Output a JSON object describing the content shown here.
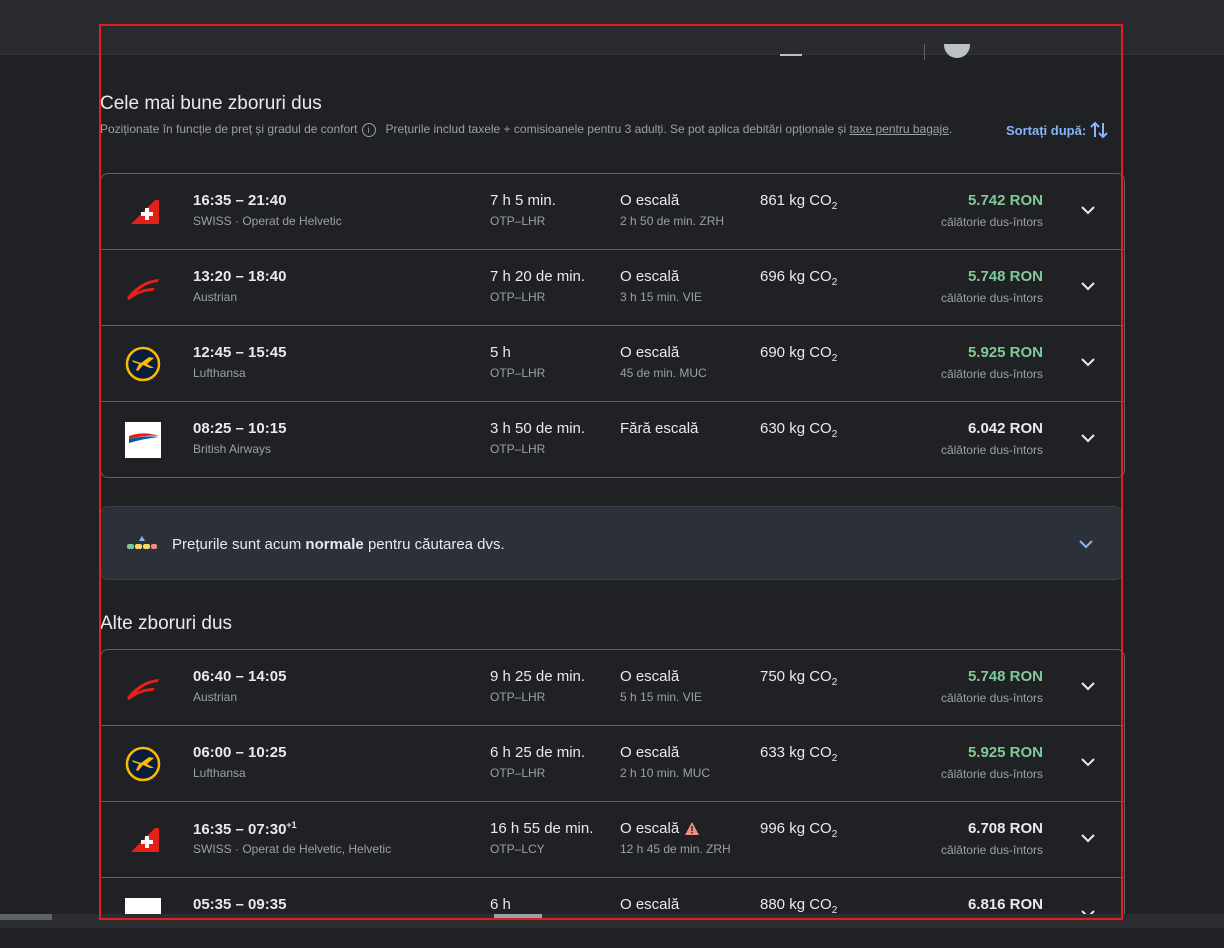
{
  "colors": {
    "accent_green": "#81c995",
    "link_blue": "#8ab4f8",
    "frame_red": "#e02020"
  },
  "best": {
    "title": "Cele mai bune zboruri dus",
    "subtitle_rank": "Poziționate în funcție de preț și gradul de confort",
    "subtitle_prices": "Prețurile includ taxele + comisioanele pentru 3 adulți. Se pot aplica debitări opționale și",
    "subtitle_link": "taxe pentru bagaje",
    "subtitle_end": "."
  },
  "sort": {
    "label": "Sortați după:"
  },
  "flights_best": [
    {
      "times": "16:35 – 21:40",
      "plus": "",
      "airline": "SWISS · Operat de Helvetic",
      "logo": "swiss",
      "duration": "7 h 5 min.",
      "route": "OTP–LHR",
      "stops": "O escală",
      "warning": false,
      "stop_info": "2 h 50 de min. ZRH",
      "co2": "861 kg CO",
      "price": "5.742 RON",
      "green": true,
      "price_type": "călătorie dus-întors"
    },
    {
      "times": "13:20 – 18:40",
      "plus": "",
      "airline": "Austrian",
      "logo": "austrian",
      "duration": "7 h 20 de min.",
      "route": "OTP–LHR",
      "stops": "O escală",
      "warning": false,
      "stop_info": "3 h 15 min. VIE",
      "co2": "696 kg CO",
      "price": "5.748 RON",
      "green": true,
      "price_type": "călătorie dus-întors"
    },
    {
      "times": "12:45 – 15:45",
      "plus": "",
      "airline": "Lufthansa",
      "logo": "lufthansa",
      "duration": "5 h",
      "route": "OTP–LHR",
      "stops": "O escală",
      "warning": false,
      "stop_info": "45 de min. MUC",
      "co2": "690 kg CO",
      "price": "5.925 RON",
      "green": true,
      "price_type": "călătorie dus-întors"
    },
    {
      "times": "08:25 – 10:15",
      "plus": "",
      "airline": "British Airways",
      "logo": "ba",
      "duration": "3 h 50 de min.",
      "route": "OTP–LHR",
      "stops": "Fără escală",
      "warning": false,
      "stop_info": "",
      "co2": "630 kg CO",
      "price": "6.042 RON",
      "green": false,
      "price_type": "călătorie dus-întors"
    }
  ],
  "insight": {
    "prefix": "Prețurile sunt acum",
    "emphasis": "normale",
    "suffix": "pentru căutarea dvs."
  },
  "other": {
    "title": "Alte zboruri dus"
  },
  "flights_other": [
    {
      "times": "06:40 – 14:05",
      "plus": "",
      "airline": "Austrian",
      "logo": "austrian",
      "duration": "9 h 25 de min.",
      "route": "OTP–LHR",
      "stops": "O escală",
      "warning": false,
      "stop_info": "5 h 15 min. VIE",
      "co2": "750 kg CO",
      "price": "5.748 RON",
      "green": true,
      "price_type": "călătorie dus-întors"
    },
    {
      "times": "06:00 – 10:25",
      "plus": "",
      "airline": "Lufthansa",
      "logo": "lufthansa",
      "duration": "6 h 25 de min.",
      "route": "OTP–LHR",
      "stops": "O escală",
      "warning": false,
      "stop_info": "2 h 10 min. MUC",
      "co2": "633 kg CO",
      "price": "5.925 RON",
      "green": true,
      "price_type": "călătorie dus-întors"
    },
    {
      "times": "16:35 – 07:30",
      "plus": "+1",
      "airline": "SWISS · Operat de Helvetic, Helvetic",
      "logo": "swiss",
      "duration": "16 h 55 de min.",
      "route": "OTP–LCY",
      "stops": "O escală",
      "warning": true,
      "stop_info": "12 h 45 de min. ZRH",
      "co2": "996 kg CO",
      "price": "6.708 RON",
      "green": false,
      "price_type": "călătorie dus-întors"
    },
    {
      "times": "05:35 – 09:35",
      "plus": "",
      "airline": "",
      "logo": "lot",
      "duration": "6 h",
      "route": "",
      "stops": "O escală",
      "warning": false,
      "stop_info": "",
      "co2": "880 kg CO",
      "price": "6.816 RON",
      "green": false,
      "price_type": ""
    }
  ],
  "co2_subscript": "2"
}
